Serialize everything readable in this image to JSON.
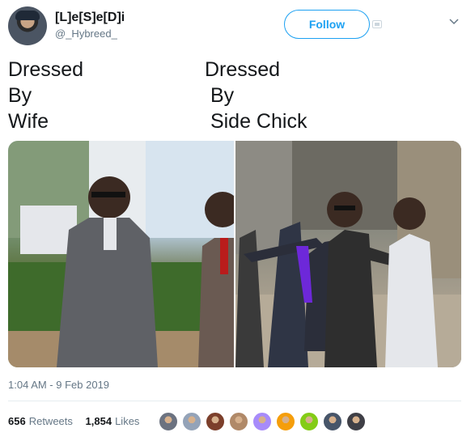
{
  "tweet": {
    "author": {
      "display_name": "[L]e[S]e[D]i",
      "handle": "@_Hybreed_"
    },
    "follow_label": "Follow",
    "text": {
      "left_lines": [
        "Dressed",
        "By",
        "Wife"
      ],
      "right_lines": [
        "Dressed",
        " By",
        " Side Chick"
      ]
    },
    "timestamp": "1:04 AM - 9 Feb 2019",
    "stats": {
      "retweets_count": "656",
      "retweets_label": "Retweets",
      "likes_count": "1,854",
      "likes_label": "Likes"
    },
    "likers": [
      "#6b7280",
      "#94a3b8",
      "#7c3f2b",
      "#b08968",
      "#a78bfa",
      "#f59e0b",
      "#84cc16",
      "#475569",
      "#3f3f46"
    ]
  },
  "colors": {
    "accent": "#1da1f2",
    "text_primary": "#14171a",
    "text_secondary": "#657786"
  },
  "icons": {
    "chevron": "chevron-down-icon",
    "badge": "media-badge-icon"
  }
}
